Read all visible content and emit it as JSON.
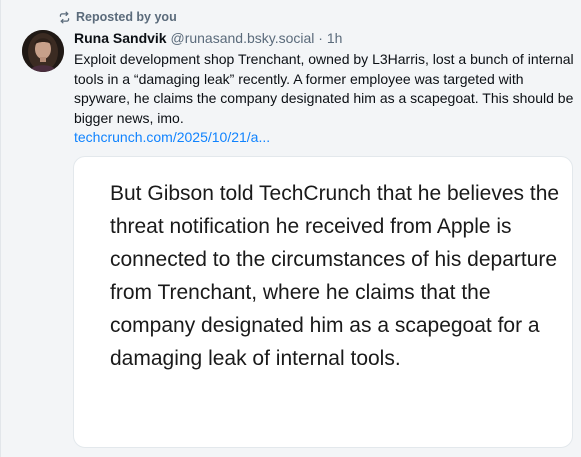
{
  "repost": {
    "icon": "repost-icon",
    "label": "Reposted by you"
  },
  "author": {
    "name": "Runa Sandvik",
    "handle": "@runasand.bsky.social",
    "separator": "·",
    "time": "1h",
    "avatar_icon": "avatar"
  },
  "post": {
    "text": "Exploit development shop Trenchant, owned by L3Harris, lost a bunch of internal tools in a “damaging leak” recently. A former employee was targeted with spyware, he claims the company designated him as a scapegoat. This should be bigger news, imo.",
    "link": "techcrunch.com/2025/10/21/a..."
  },
  "embed": {
    "quote": "But Gibson told TechCrunch that he believes the threat notification he received from Apple is connected to the circumstances of his departure from Trenchant, where he claims that the company designated him as a scapegoat for a damaging leak of internal tools."
  },
  "colors": {
    "link": "#1083fe",
    "muted": "#5b6b7b",
    "background": "#f3f5f7"
  }
}
